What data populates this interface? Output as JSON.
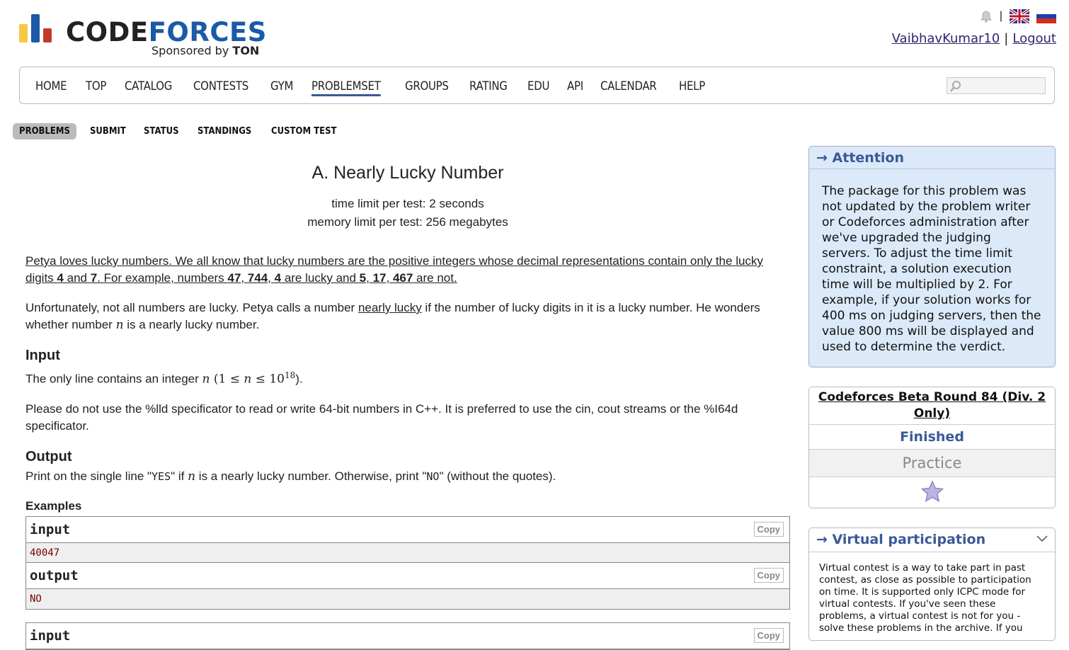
{
  "brand": {
    "word_dark": "CODE",
    "word_blue": "FORCES",
    "sponsor_prefix": "Sponsored by",
    "sponsor_name": "TON",
    "bar_colors": [
      "#f7c844",
      "#1a5aa8",
      "#c0392b"
    ]
  },
  "header": {
    "separator": "|",
    "username": "VaibhavKumar10",
    "user_sep": "|",
    "logout": "Logout"
  },
  "menu": {
    "items": [
      "Home",
      "Top",
      "Catalog",
      "Contests",
      "Gym",
      "Problemset",
      "Groups",
      "Rating",
      "Edu",
      "API",
      "Calendar",
      "Help"
    ],
    "active": "Problemset"
  },
  "submenu": {
    "items": [
      "PROBLEMS",
      "SUBMIT",
      "STATUS",
      "STANDINGS",
      "CUSTOM TEST"
    ],
    "active": "PROBLEMS"
  },
  "problem": {
    "title": "A. Nearly Lucky Number",
    "time_limit": "time limit per test: 2 seconds",
    "memory_limit": "memory limit per test: 256 megabytes",
    "legend1_a": "Petya loves lucky numbers. We all know that lucky numbers are the positive integers whose decimal representations contain only the lucky digits ",
    "legend1_b": "4",
    "legend1_c": " and ",
    "legend1_d": "7",
    "legend1_e": ". For example, numbers ",
    "legend1_f": "47",
    "legend1_g": ", ",
    "legend1_h": "744",
    "legend1_i": ", ",
    "legend1_j": "4",
    "legend1_k": " are lucky and ",
    "legend1_l": "5",
    "legend1_m": ", ",
    "legend1_n": "17",
    "legend1_o": ", ",
    "legend1_p": "467",
    "legend1_q": " are not.",
    "legend2_a": "Unfortunately, not all numbers are lucky. Petya calls a number ",
    "legend2_b": "nearly lucky",
    "legend2_c": " if the number of lucky digits in it is a lucky number. He wonders whether number ",
    "legend2_var": "n",
    "legend2_d": " is a nearly lucky number.",
    "input_title": "Input",
    "input_a": "The only line contains an integer ",
    "input_var": "n",
    "input_b": " (1 ≤ ",
    "input_var2": "n",
    "input_c": " ≤ 10",
    "input_sup": "18",
    "input_d": ").",
    "note": "Please do not use the %lld specificator to read or write 64-bit numbers in С++. It is preferred to use the cin, cout streams or the %I64d specificator.",
    "output_title": "Output",
    "output_a": "Print on the single line \"",
    "output_yes": "YES",
    "output_b": "\" if ",
    "output_var": "n",
    "output_c": " is a nearly lucky number. Otherwise, print \"",
    "output_no": "NO",
    "output_d": "\" (without the quotes).",
    "examples_title": "Examples",
    "examples": [
      {
        "input_label": "input",
        "input_value": "40047",
        "output_label": "output",
        "output_value": "NO",
        "copy": "Copy"
      },
      {
        "input_label": "input",
        "copy": "Copy"
      }
    ]
  },
  "sidebar": {
    "attention_title": "→ Attention",
    "attention_text": "The package for this problem was not updated by the problem writer or Codeforces administration after we've upgraded the judging servers. To adjust the time limit constraint, a solution execution time will be multiplied by 2. For example, if your solution works for 400 ms on judging servers, then the value 800 ms will be displayed and used to determine the verdict.",
    "round_name": "Codeforces Beta Round 84 (Div. 2 Only)",
    "round_state": "Finished",
    "round_mode": "Practice",
    "virtual_title": "→ Virtual participation",
    "virtual_text": "Virtual contest is a way to take part in past contest, as close as possible to participation on time. It is supported only ICPC mode for virtual contests. If you've seen these problems, a virtual contest is not for you - solve these problems in the archive. If you"
  }
}
